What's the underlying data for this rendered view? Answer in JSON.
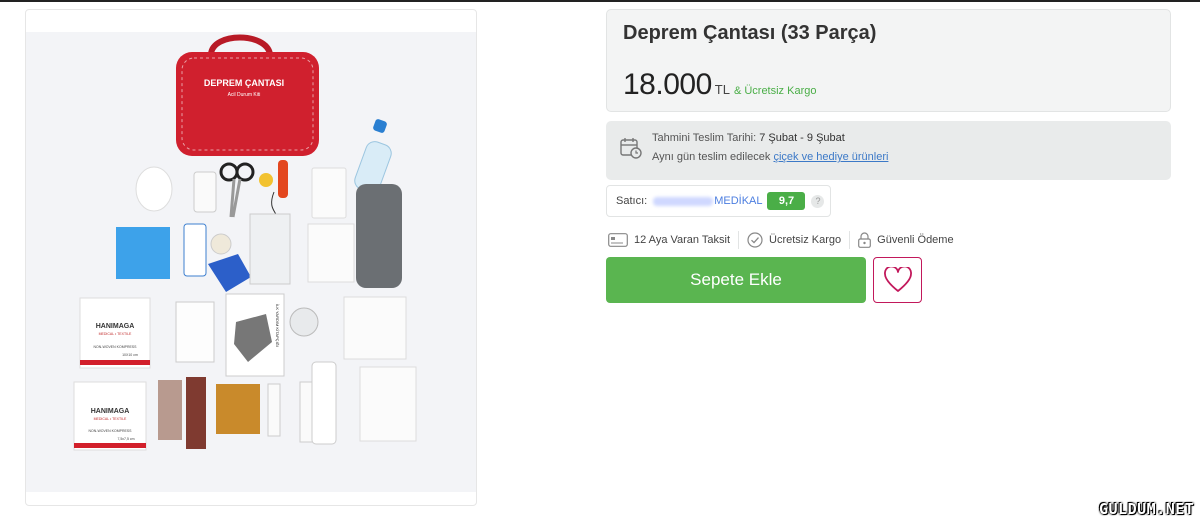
{
  "product": {
    "title": "Deprem Çantası (33 Parça)",
    "price": "18.000",
    "currency": "TL",
    "shipping_note": "& Ücretsiz Kargo"
  },
  "photo": {
    "bag_title": "DEPREM ÇANTASI",
    "bag_subtitle": "Acil Durum Kiti",
    "compress_brand": "HANIMAGA",
    "compress_sub": "MEDICAL • TEXTILE",
    "compress_type": "NON-WOVEN KOMPRESS",
    "compress_size_1": "10X10 cm",
    "compress_size_2": "7,5x7,5 cm",
    "booklet_title": "İLK YARDIM KİTAPÇIĞI"
  },
  "delivery": {
    "label": "Tahmini Teslim Tarihi:",
    "date": "7 Şubat - 9 Şubat",
    "note_prefix": "Aynı gün teslim edilecek",
    "note_link": "çiçek ve hediye ürünleri"
  },
  "seller": {
    "label": "Satıcı:",
    "name": "MEDİKAL",
    "score": "9,7",
    "help": "?"
  },
  "features": {
    "installment": "12 Aya Varan Taksit",
    "shipping": "Ücretsiz Kargo",
    "payment": "Güvenli Ödeme"
  },
  "actions": {
    "add_to_cart": "Sepete Ekle"
  },
  "watermark": "GULDUM.NET",
  "colors": {
    "accent_green": "#5ab550",
    "score_green": "#4aae47",
    "favorite_pink": "#c2185b",
    "link_blue": "#3c79c7",
    "bag_red": "#d0202e"
  },
  "icons": {
    "delivery": "calendar-clock-icon",
    "installment": "credit-card-icon",
    "shipping": "check-circle-icon",
    "payment": "lock-icon",
    "favorite": "heart-icon"
  }
}
